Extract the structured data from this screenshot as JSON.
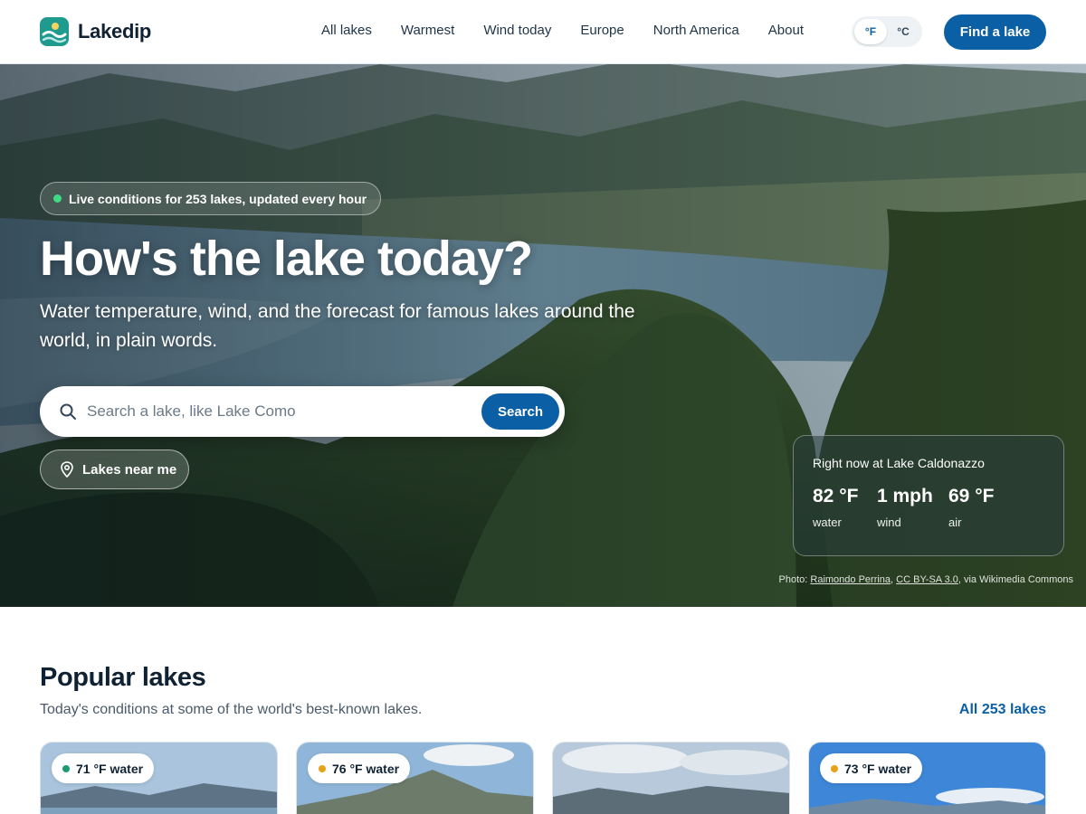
{
  "brand": {
    "name": "Lakedip"
  },
  "nav": {
    "items": [
      {
        "label": "All lakes"
      },
      {
        "label": "Warmest"
      },
      {
        "label": "Wind today"
      },
      {
        "label": "Europe"
      },
      {
        "label": "North America"
      },
      {
        "label": "About"
      }
    ]
  },
  "units": {
    "fahrenheit": "°F",
    "celsius": "°C",
    "selected": "°F"
  },
  "header": {
    "cta_label": "Find a lake"
  },
  "hero": {
    "live_pill": "Live conditions for 253 lakes, updated every hour",
    "title": "How's the lake today?",
    "subtitle": "Water temperature, wind, and the forecast for famous lakes around the world, in plain words.",
    "search": {
      "placeholder": "Search a lake, like Lake Como",
      "value": "",
      "button_label": "Search"
    },
    "near_me_label": "Lakes near me",
    "now_card": {
      "title": "Right now at Lake Caldonazzo",
      "stats": [
        {
          "value": "82 °F",
          "label": "water"
        },
        {
          "value": "1 mph",
          "label": "wind"
        },
        {
          "value": "69 °F",
          "label": "air"
        }
      ]
    },
    "credit": {
      "prefix": "Photo:",
      "author": "Raimondo Perrina",
      "license": "CC BY-SA 3.0",
      "suffix": ", via Wikimedia Commons"
    }
  },
  "popular": {
    "title": "Popular lakes",
    "subtitle": "Today's conditions at some of the world's best-known lakes.",
    "all_link": "All 253 lakes",
    "cards": [
      {
        "badge": "71 °F water",
        "dot_color": "#1f9a6e"
      },
      {
        "badge": "76 °F water",
        "dot_color": "#e8a21a"
      },
      {
        "badge": "",
        "dot_color": ""
      },
      {
        "badge": "73 °F water",
        "dot_color": "#e8a21a"
      }
    ]
  },
  "colors": {
    "primary": "#0b5fa5",
    "brand": "#1f9a8e",
    "live": "#3ddc84"
  }
}
